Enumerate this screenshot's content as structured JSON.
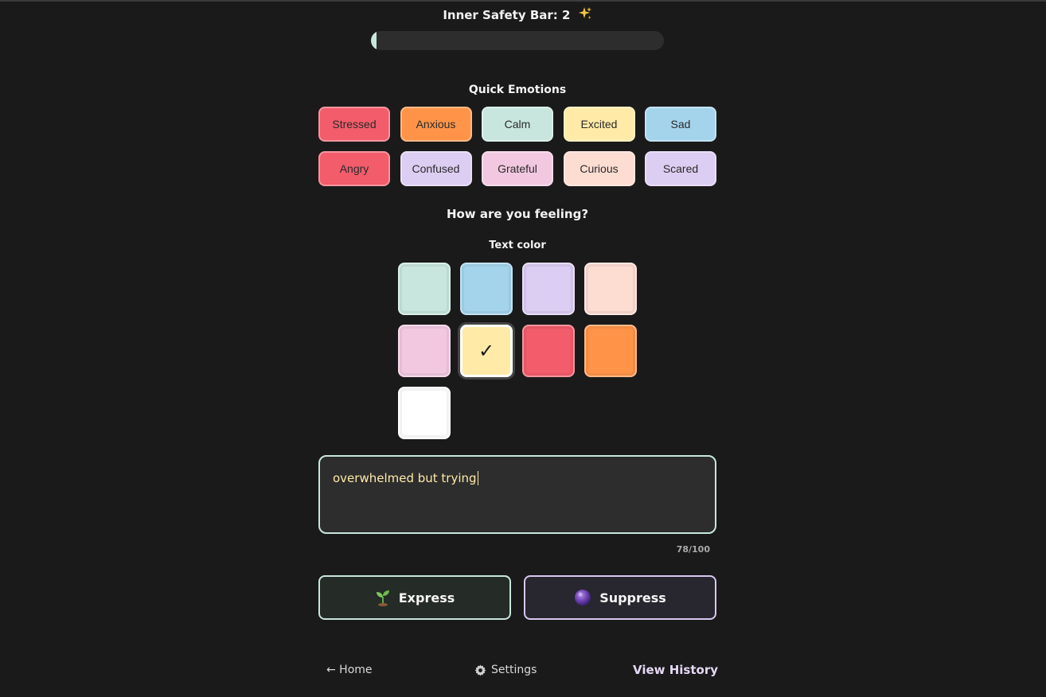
{
  "header": {
    "safety_title": "Inner Safety Bar: 2",
    "safety_icon": "sparkles-icon",
    "safety_value_percent": 2,
    "accent_color": "#c8e6de"
  },
  "quick_emotions": {
    "label": "Quick Emotions",
    "items": [
      {
        "label": "Stressed",
        "color": "#f25c6b"
      },
      {
        "label": "Anxious",
        "color": "#ff9448"
      },
      {
        "label": "Calm",
        "color": "#c8e6de"
      },
      {
        "label": "Excited",
        "color": "#ffeaa7"
      },
      {
        "label": "Sad",
        "color": "#a4d4ec"
      },
      {
        "label": "Angry",
        "color": "#f25c6b"
      },
      {
        "label": "Confused",
        "color": "#dccdf2"
      },
      {
        "label": "Grateful",
        "color": "#f2c8e0"
      },
      {
        "label": "Curious",
        "color": "#fddcd2"
      },
      {
        "label": "Scared",
        "color": "#dccdf2"
      }
    ]
  },
  "prompt": {
    "title": "How are you feeling?",
    "text_color_label": "Text color"
  },
  "text_colors": {
    "selected_index": 5,
    "selected_mark": "✓",
    "swatches": [
      "#c8e6de",
      "#a4d4ec",
      "#dccdf2",
      "#fddcd2",
      "#f2c8e0",
      "#ffeaa7",
      "#f25c6b",
      "#ff9448",
      "#ffffff"
    ]
  },
  "input": {
    "value": "overwhelmed but trying",
    "counter": "78/100"
  },
  "actions": {
    "express_label": "Express",
    "express_icon": "seedling-icon",
    "suppress_label": "Suppress",
    "suppress_icon": "purple-orb-icon"
  },
  "nav": {
    "home_label": "← Home",
    "settings_label": "Settings",
    "settings_icon": "gear-icon",
    "history_label": "View History"
  }
}
